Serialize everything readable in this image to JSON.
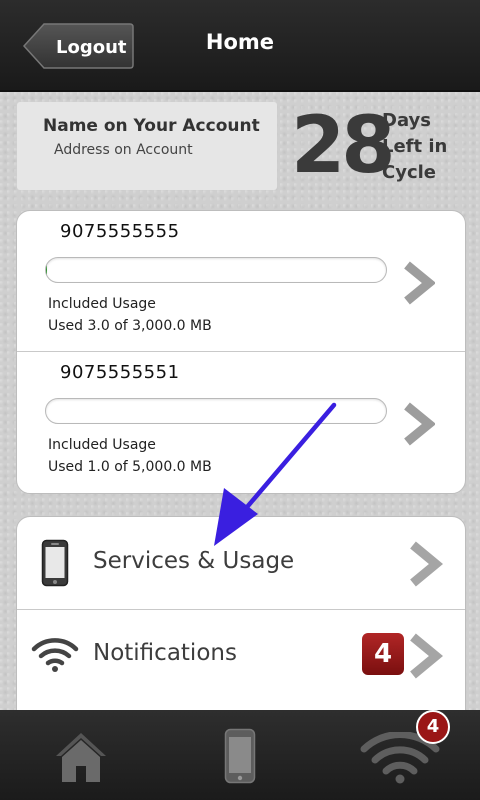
{
  "header": {
    "back_label": "Logout",
    "title": "Home"
  },
  "account": {
    "name": "Name on Your Account",
    "address": "Address on Account",
    "days_left": "28",
    "days_line1": "Days",
    "days_line2": "Left in",
    "days_line3": "Cycle"
  },
  "lines": [
    {
      "number": "9075555555",
      "usage_label": "Included Usage",
      "usage_detail": "Used 3.0 of 3,000.0 MB",
      "usage_fraction": 0.001
    },
    {
      "number": "9075555551",
      "usage_label": "Included Usage",
      "usage_detail": "Used 1.0 of 5,000.0 MB",
      "usage_fraction": 0.0002
    }
  ],
  "menu": {
    "services_label": "Services & Usage",
    "services_icon": "phone-icon",
    "notifications_label": "Notifications",
    "notifications_icon": "wifi-icon",
    "notifications_count": "4"
  },
  "tabbar": {
    "items": [
      {
        "icon": "home-icon"
      },
      {
        "icon": "phone-icon"
      },
      {
        "icon": "wifi-icon"
      }
    ],
    "badge_count": "4"
  },
  "colors": {
    "annotation_arrow": "#3a1fe0",
    "badge": "#9a1616"
  }
}
